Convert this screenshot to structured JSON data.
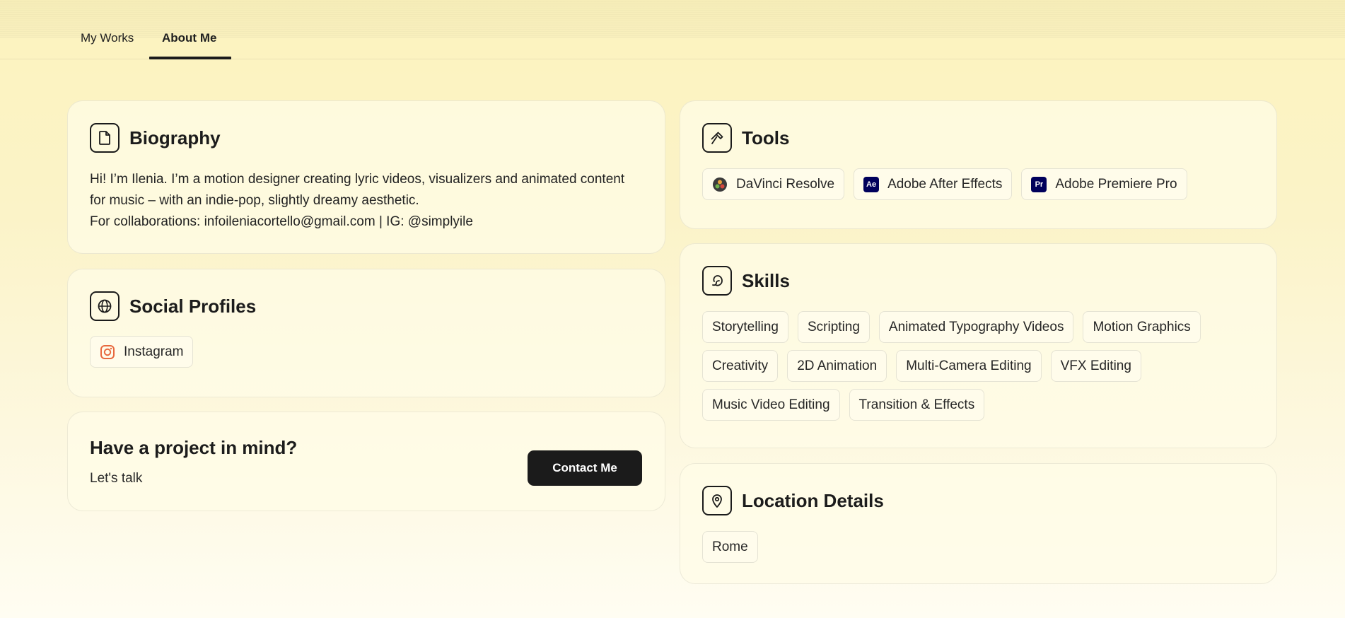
{
  "nav": {
    "tabs": [
      {
        "label": "My Works",
        "active": false
      },
      {
        "label": "About Me",
        "active": true
      }
    ]
  },
  "biography": {
    "title": "Biography",
    "icon": "document-icon",
    "line1": "Hi! I’m Ilenia. I’m a motion designer creating lyric videos, visualizers and animated content for music – with an indie-pop, slightly dreamy aesthetic.",
    "line2": "For collaborations: infoileniacortello@gmail.com | IG: @simplyile"
  },
  "social": {
    "title": "Social Profiles",
    "icon": "globe-icon",
    "items": [
      {
        "label": "Instagram",
        "icon": "instagram-icon"
      }
    ]
  },
  "cta": {
    "title": "Have a project in mind?",
    "subtitle": "Let's talk",
    "button": "Contact Me"
  },
  "tools": {
    "title": "Tools",
    "icon": "hammer-icon",
    "items": [
      {
        "label": "DaVinci Resolve",
        "icon": "davinci-resolve-icon"
      },
      {
        "label": "Adobe After Effects",
        "icon": "after-effects-icon",
        "abbr": "Ae"
      },
      {
        "label": "Adobe Premiere Pro",
        "icon": "premiere-pro-icon",
        "abbr": "Pr"
      }
    ]
  },
  "skills": {
    "title": "Skills",
    "icon": "palette-icon",
    "items": [
      "Storytelling",
      "Scripting",
      "Animated Typography Videos",
      "Motion Graphics",
      "Creativity",
      "2D Animation",
      "Multi-Camera Editing",
      "VFX Editing",
      "Music Video Editing",
      "Transition & Effects"
    ]
  },
  "location": {
    "title": "Location Details",
    "icon": "map-pin-icon",
    "items": [
      "Rome"
    ]
  },
  "colors": {
    "background": "#fbf3c8",
    "accent_dark": "#1b1b1b",
    "adobe_navy": "#00005b"
  }
}
